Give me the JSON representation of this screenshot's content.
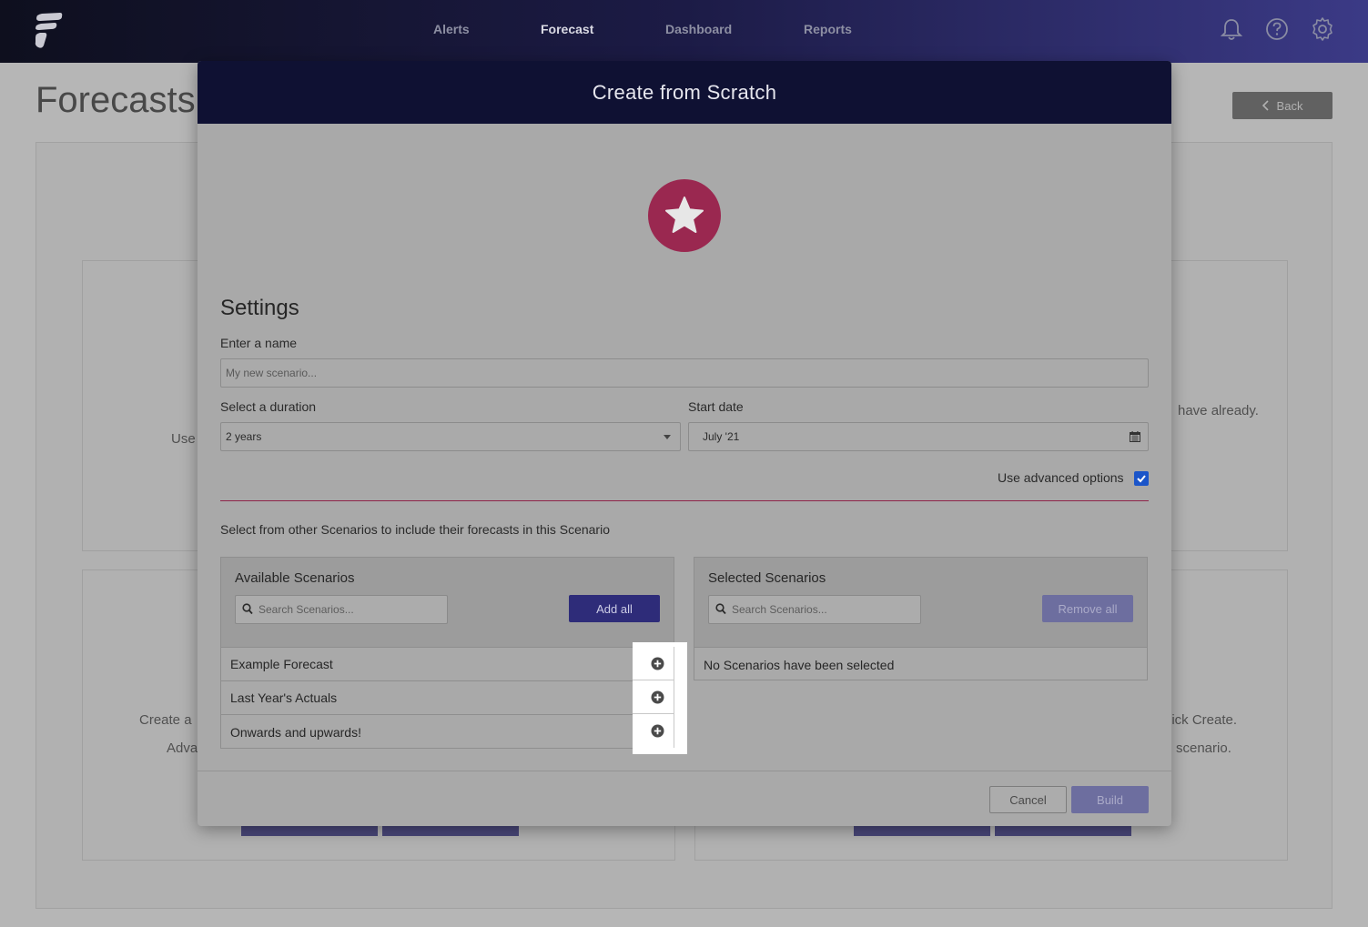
{
  "nav": {
    "links": [
      "Alerts",
      "Forecast",
      "Dashboard",
      "Reports"
    ],
    "active": "Forecast",
    "icons": [
      "bell-icon",
      "help-icon",
      "gear-icon"
    ]
  },
  "background": {
    "page_title": "Forecasts",
    "back_label": "Back",
    "text_left_1": "Use",
    "text_right_1": "have already.",
    "text_left_2": "Create a",
    "text_left_3": "Adva",
    "text_right_2": "uick Create.",
    "text_right_3": "scenario."
  },
  "modal": {
    "title": "Create from Scratch",
    "badge_icon": "star-icon",
    "settings_title": "Settings",
    "name_label": "Enter a name",
    "name_placeholder": "My new scenario...",
    "duration_label": "Select a duration",
    "duration_value": "2 years",
    "start_label": "Start date",
    "start_value": "July '21",
    "advanced_label": "Use advanced options",
    "advanced_checked": true,
    "intro": "Select from other Scenarios to include their forecasts in this Scenario",
    "available": {
      "title": "Available Scenarios",
      "search_placeholder": "Search Scenarios...",
      "add_all": "Add all",
      "items": [
        "Example Forecast",
        "Last Year's Actuals",
        "Onwards and upwards!"
      ]
    },
    "selected": {
      "title": "Selected Scenarios",
      "search_placeholder": "Search Scenarios...",
      "remove_all": "Remove all",
      "empty": "No Scenarios have been selected"
    },
    "cancel": "Cancel",
    "build": "Build"
  },
  "colors": {
    "accent": "#2e2c79",
    "badge": "#9a2850",
    "divider": "#8e2348",
    "checkbox": "#1b55c9"
  }
}
